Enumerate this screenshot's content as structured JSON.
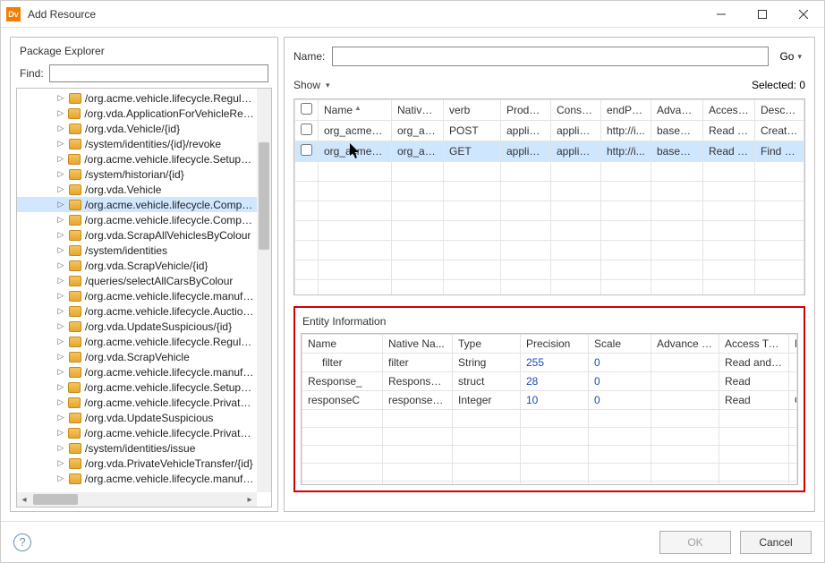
{
  "window": {
    "title": "Add Resource",
    "app_icon_text": "Dv"
  },
  "package_explorer": {
    "title": "Package Explorer",
    "find_label": "Find:",
    "find_value": "",
    "items": [
      "/org.acme.vehicle.lifecycle.Regulator",
      "/org.vda.ApplicationForVehicleRegistra",
      "/org.vda.Vehicle/{id}",
      "/system/identities/{id}/revoke",
      "/org.acme.vehicle.lifecycle.SetupDemo",
      "/system/historian/{id}",
      "/org.vda.Vehicle",
      "/org.acme.vehicle.lifecycle.Company",
      "/org.acme.vehicle.lifecycle.Company/{",
      "/org.vda.ScrapAllVehiclesByColour",
      "/system/identities",
      "/org.vda.ScrapVehicle/{id}",
      "/queries/selectAllCarsByColour",
      "/org.acme.vehicle.lifecycle.manufactu",
      "/org.acme.vehicle.lifecycle.AuctionHo",
      "/org.vda.UpdateSuspicious/{id}",
      "/org.acme.vehicle.lifecycle.Regulator/{",
      "/org.vda.ScrapVehicle",
      "/org.acme.vehicle.lifecycle.manufactu",
      "/org.acme.vehicle.lifecycle.SetupDemo",
      "/org.acme.vehicle.lifecycle.PrivateOwn",
      "/org.vda.UpdateSuspicious",
      "/org.acme.vehicle.lifecycle.PrivateOwn",
      "/system/identities/issue",
      "/org.vda.PrivateVehicleTransfer/{id}",
      "/org.acme.vehicle.lifecycle.manufactu"
    ],
    "selected_index": 7
  },
  "right": {
    "name_label": "Name:",
    "name_value": "",
    "go_label": "Go",
    "show_label": "Show",
    "selected_label": "Selected: 0"
  },
  "resources": {
    "columns": [
      "",
      "Name",
      "Native ...",
      "verb",
      "Produc...",
      "Consu...",
      "endPoi...",
      "Advanc...",
      "Access ...",
      "Descrip..."
    ],
    "rows": [
      {
        "checked": false,
        "selected": false,
        "cells": [
          "org_acme_v...",
          "org_ac...",
          "POST",
          "applica...",
          "applica...",
          "http://i...",
          "baseUr...",
          "Read a...",
          "Create ..."
        ]
      },
      {
        "checked": false,
        "selected": true,
        "cells": [
          "org_acme_v...",
          "org_ac...",
          "GET",
          "applica...",
          "applica...",
          "http://i...",
          "baseUr...",
          "Read a...",
          "Find all..."
        ]
      }
    ]
  },
  "entity": {
    "title": "Entity Information",
    "columns": [
      "Name",
      "Native Na...",
      "Type",
      "Precision",
      "Scale",
      "Advance P...",
      "Access Type",
      "Description"
    ],
    "rows": [
      {
        "indent": true,
        "cells": [
          "filter",
          "filter",
          "String",
          "255",
          "0",
          "",
          "Read and ...",
          ""
        ]
      },
      {
        "indent": false,
        "cells": [
          "Response_",
          "Response_...",
          "struct",
          "28",
          "0",
          "",
          "Read",
          ""
        ]
      },
      {
        "indent": false,
        "cells": [
          "responseC",
          "responseC...",
          "Integer",
          "10",
          "0",
          "",
          "Read",
          "Code retur..."
        ]
      }
    ]
  },
  "footer": {
    "ok": "OK",
    "cancel": "Cancel"
  }
}
